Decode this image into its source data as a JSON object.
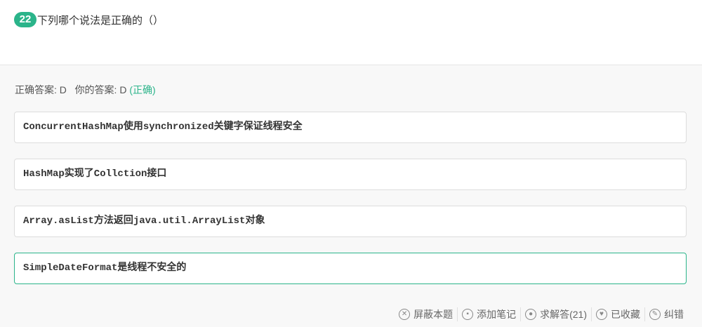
{
  "question": {
    "number": "22",
    "text": "下列哪个说法是正确的（）"
  },
  "answer": {
    "correct_label": "正确答案: D",
    "your_label": "你的答案: D",
    "status": "(正确)"
  },
  "options": [
    "ConcurrentHashMap使用synchronized关键字保证线程安全",
    "HashMap实现了Collction接口",
    "Array.asList方法返回java.util.ArrayList对象",
    "SimpleDateFormat是线程不安全的"
  ],
  "actions": [
    {
      "label": "屏蔽本题",
      "icon": "close-circle-icon"
    },
    {
      "label": "添加笔记",
      "icon": "book-icon"
    },
    {
      "label": "求解答(21)",
      "icon": "comment-icon"
    },
    {
      "label": "已收藏",
      "icon": "heart-icon"
    },
    {
      "label": "纠错",
      "icon": "pencil-icon"
    }
  ]
}
